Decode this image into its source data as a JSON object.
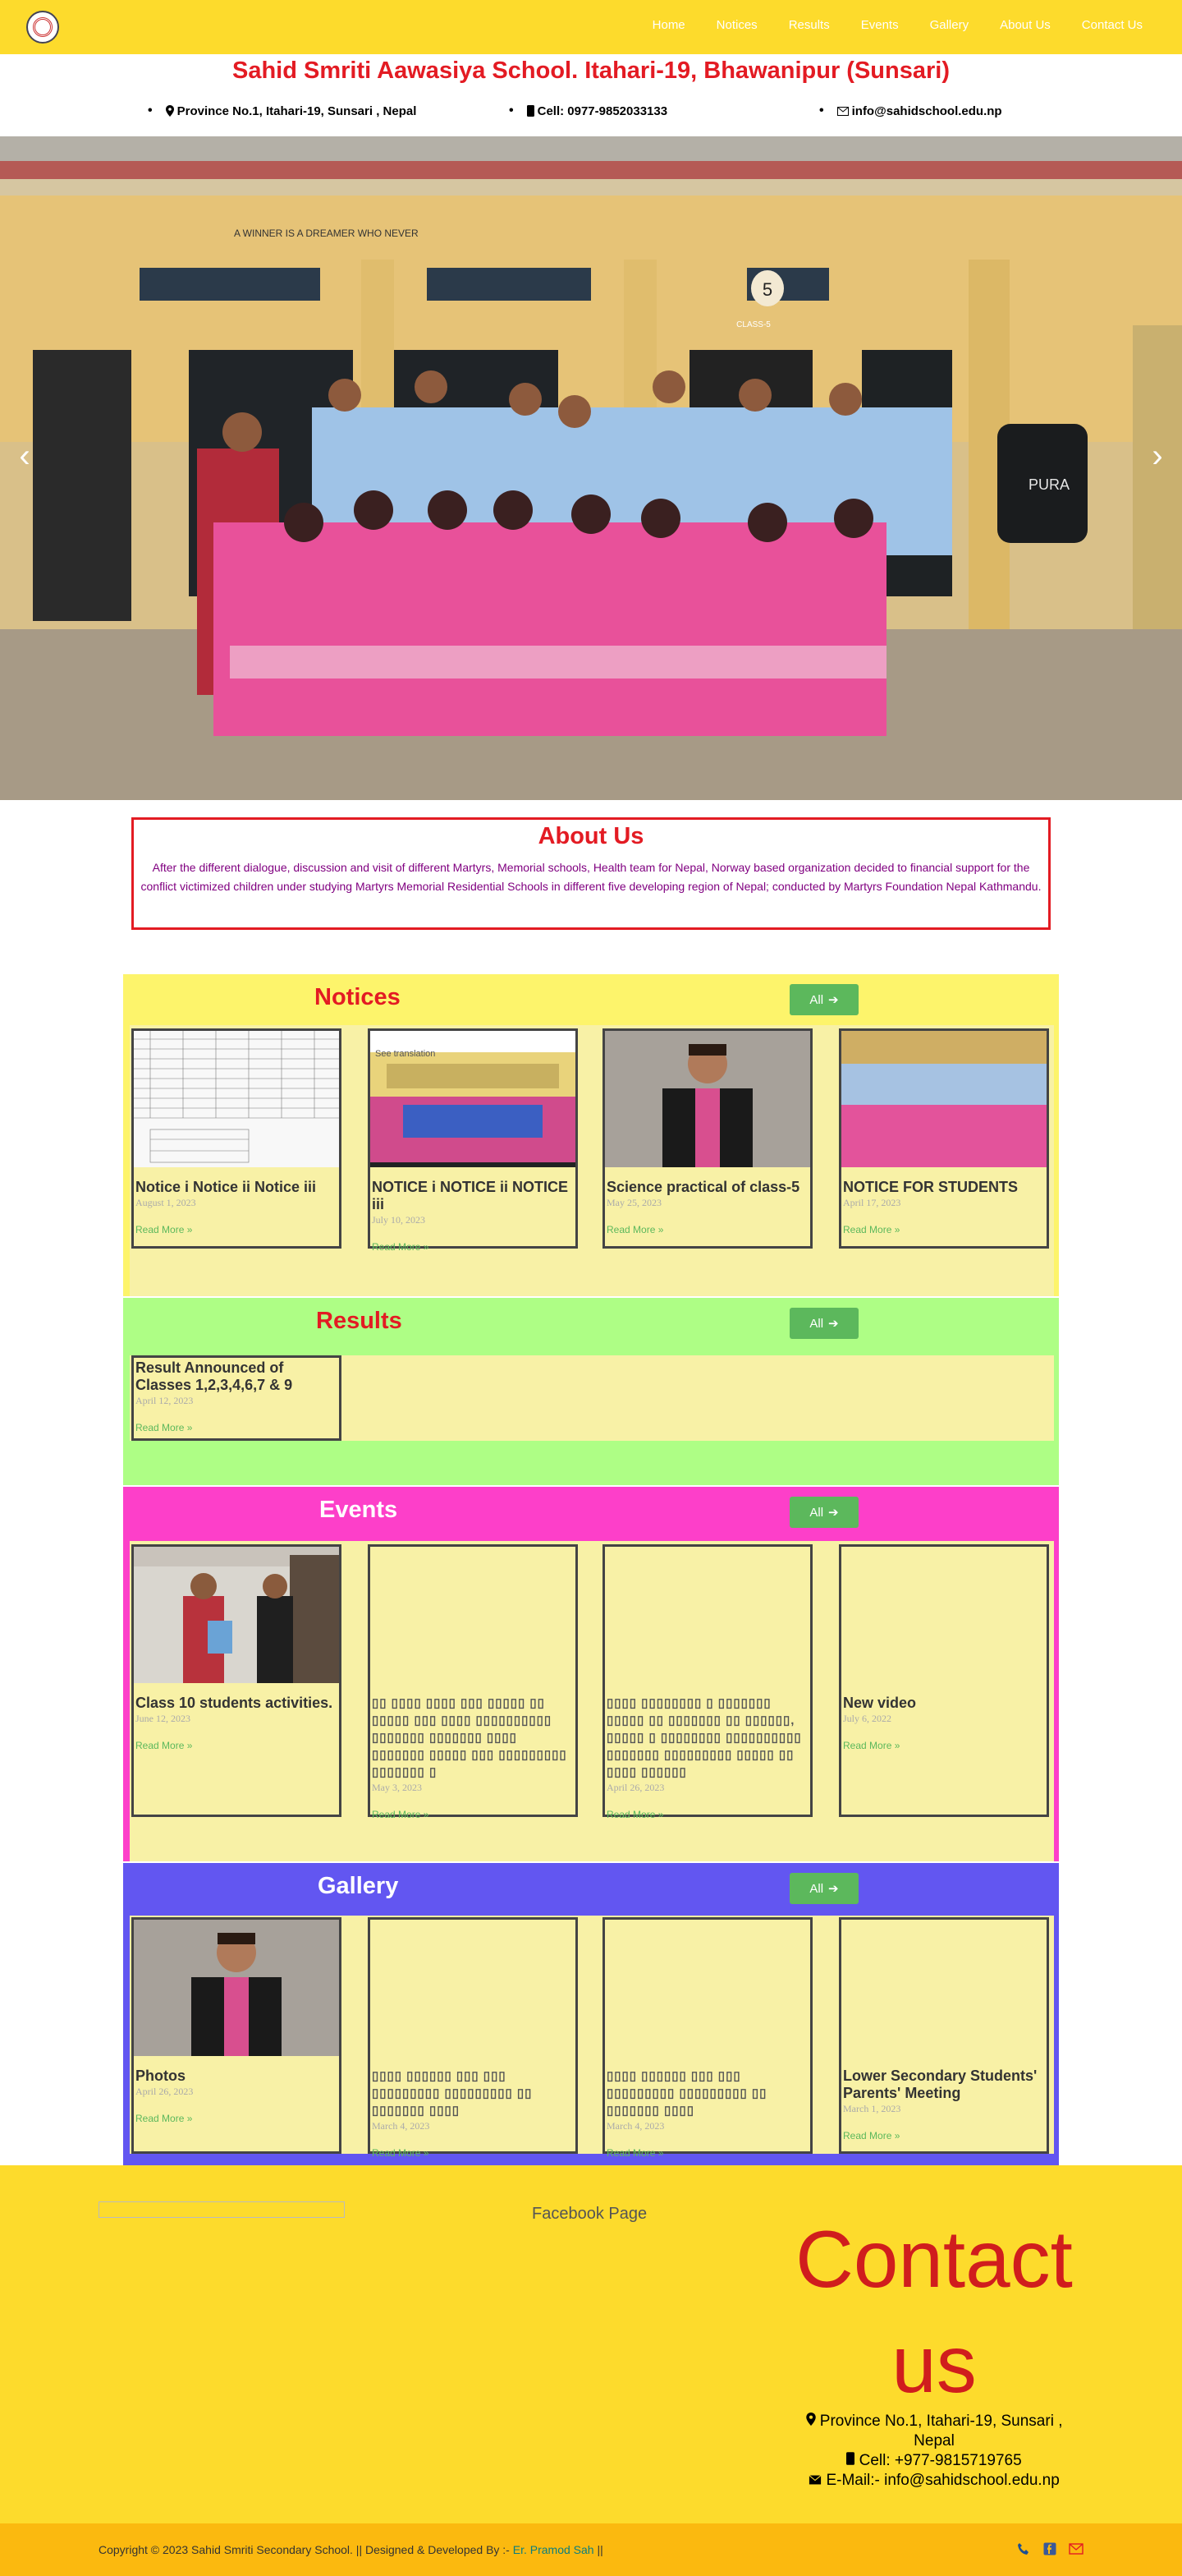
{
  "nav": {
    "logo_alt": "School logo",
    "links": [
      "Home",
      "Notices",
      "Results",
      "Events",
      "Gallery",
      "About Us",
      "Contact Us"
    ]
  },
  "header": {
    "title": "Sahid Smriti Aawasiya School. Itahari-19, Bhawanipur (Sunsari)",
    "address": "Province No.1, Itahari-19, Sunsari , Nepal",
    "cell": "Cell: 0977-9852033133",
    "email": "info@sahidschool.edu.np"
  },
  "hero": {
    "banner_text_left": "A WINNER IS A DREAMER WHO NEVER",
    "class_label": "CLASS-5",
    "tank_brand": "PURA"
  },
  "about": {
    "title": "About Us",
    "body": "After the different dialogue, discussion and visit of different Martyrs, Memorial schools, Health team for Nepal, Norway based organization decided to financial support for the conflict victimized children under studying Martyrs Memorial Residential Schools in different five developing region of Nepal; conducted by Martyrs Foundation Nepal Kathmandu."
  },
  "colors": {
    "nav_bg": "#fddb2c",
    "title_red": "#e31b23",
    "notices_bg": "#fdf46b",
    "results_bg": "#aefe85",
    "events_bg": "#fd3fc9",
    "gallery_bg": "#6256f1",
    "card_bg": "#f8f1a6",
    "button_green": "#5cb85c"
  },
  "read_more": "Read More »",
  "all_label": "All",
  "notices": {
    "title": "Notices",
    "items": [
      {
        "title": "Notice i Notice ii Notice iii",
        "date": "August 1, 2023"
      },
      {
        "title": "NOTICE i NOTICE ii NOTICE iii",
        "date": "July 10, 2023",
        "thumb_caption": "See translation"
      },
      {
        "title": "Science practical of class-5",
        "date": "May 25, 2023"
      },
      {
        "title": "NOTICE FOR STUDENTS",
        "date": "April 17, 2023"
      }
    ]
  },
  "results": {
    "title": "Results",
    "items": [
      {
        "title": "Result Announced of Classes 1,2,3,4,6,7 & 9",
        "date": "April 12, 2023"
      }
    ]
  },
  "events": {
    "title": "Events",
    "items": [
      {
        "title": "Class 10 students activities.",
        "date": "June 12, 2023"
      },
      {
        "title": "▯▯ ▯▯▯▯ ▯▯▯▯ ▯▯▯ ▯▯▯▯▯ ▯▯ ▯▯▯▯▯ ▯▯▯ ▯▯▯▯ ▯▯▯▯▯▯▯▯▯▯ ▯▯▯▯▯▯▯ ▯▯▯▯▯▯▯ ▯▯▯▯ ▯▯▯▯▯▯▯ ▯▯▯▯▯ ▯▯▯ ▯▯▯▯▯▯▯▯▯ ▯▯▯▯▯▯▯ ▯",
        "date": "May 3, 2023"
      },
      {
        "title": "▯▯▯▯ ▯▯▯▯▯▯▯▯ ▯ ▯▯▯▯▯▯▯ ▯▯▯▯▯ ▯▯ ▯▯▯▯▯▯▯ ▯▯ ▯▯▯▯▯▯, ▯▯▯▯▯ ▯ ▯▯▯▯▯▯▯▯ ▯▯▯▯▯▯▯▯▯▯ ▯▯▯▯▯▯▯ ▯▯▯▯▯▯▯▯▯ ▯▯▯▯▯ ▯▯ ▯▯▯▯ ▯▯▯▯▯▯",
        "date": "April 26, 2023"
      },
      {
        "title": "New video",
        "date": "July 6, 2022"
      }
    ]
  },
  "gallery": {
    "title": "Gallery",
    "items": [
      {
        "title": "Photos",
        "date": "April 26, 2023"
      },
      {
        "title": "▯▯▯▯ ▯▯▯▯▯▯ ▯▯▯ ▯▯▯ ▯▯▯▯▯▯▯▯▯ ▯▯▯▯▯▯▯▯▯ ▯▯ ▯▯▯▯▯▯▯ ▯▯▯▯",
        "date": "March 4, 2023"
      },
      {
        "title": "▯▯▯▯ ▯▯▯▯▯▯ ▯▯▯ ▯▯▯ ▯▯▯▯▯▯▯▯▯ ▯▯▯▯▯▯▯▯▯ ▯▯ ▯▯▯▯▯▯▯ ▯▯▯▯",
        "date": "March 4, 2023"
      },
      {
        "title": "Lower Secondary Students' Parents' Meeting",
        "date": "March 1, 2023"
      }
    ]
  },
  "footer": {
    "facebook_label": "Facebook Page",
    "contact_title": "Contact us",
    "address": "Province No.1, Itahari-19, Sunsari , Nepal",
    "cell": "Cell: +977-9815719765",
    "email": "E-Mail:- info@sahidschool.edu.np",
    "copyright": "Copyright © 2023 Sahid Smriti Secondary School. || Designed & Developed By :-",
    "developer": "Er. Pramod Sah",
    "copyright_tail": " ||"
  }
}
